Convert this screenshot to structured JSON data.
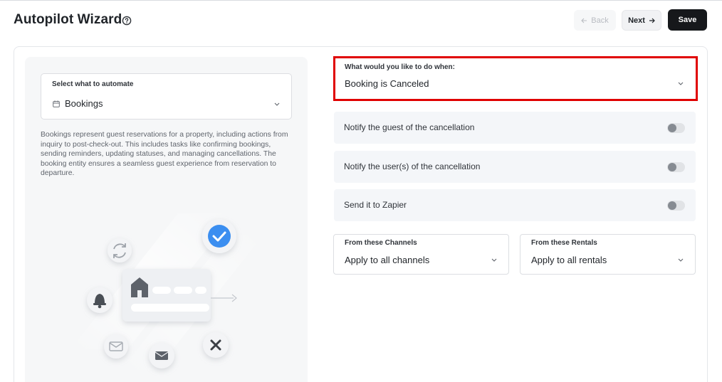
{
  "header": {
    "title": "Autopilot Wizard",
    "back_label": "Back",
    "next_label": "Next",
    "save_label": "Save"
  },
  "automate_select": {
    "label": "Select what to automate",
    "value": "Bookings",
    "icon": "calendar-icon"
  },
  "description": "Bookings represent guest reservations for a property, including actions from inquiry to post-check-out. This includes tasks like confirming bookings, sending reminders, updating statuses, and managing cancellations. The booking entity ensures a seamless guest experience from reservation to departure.",
  "trigger": {
    "label": "What would you like to do when:",
    "value": "Booking is Canceled"
  },
  "options": [
    {
      "label": "Notify the guest of the cancellation",
      "enabled": false
    },
    {
      "label": "Notify the user(s) of the cancellation",
      "enabled": false
    },
    {
      "label": "Send it to Zapier",
      "enabled": false
    }
  ],
  "channels": {
    "label": "From these Channels",
    "value": "Apply to all channels"
  },
  "rentals": {
    "label": "From these Rentals",
    "value": "Apply to all rentals"
  },
  "colors": {
    "highlight": "#e00000",
    "save_bg": "#16181b",
    "check_blue": "#3b8ef0"
  }
}
